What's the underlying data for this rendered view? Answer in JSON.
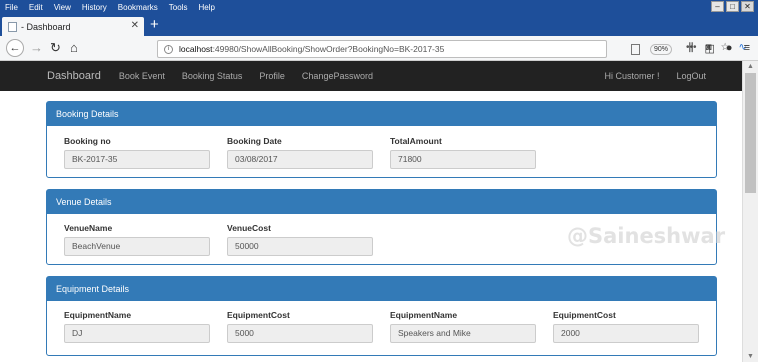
{
  "browser": {
    "menu": [
      "File",
      "Edit",
      "View",
      "History",
      "Bookmarks",
      "Tools",
      "Help"
    ],
    "tab_title": "- Dashboard",
    "url_host": "localhost",
    "url_path": ":49980/ShowAllBooking/ShowOrder?BookingNo=BK-2017-35",
    "zoom": "90%"
  },
  "nav": {
    "brand": "Dashboard",
    "links": [
      "Book Event",
      "Booking Status",
      "Profile",
      "ChangePassword"
    ],
    "greeting": "Hi Customer !",
    "logout": "LogOut"
  },
  "booking": {
    "heading": "Booking Details",
    "fields": [
      {
        "label": "Booking no",
        "value": "BK-2017-35"
      },
      {
        "label": "Booking Date",
        "value": "03/08/2017"
      },
      {
        "label": "TotalAmount",
        "value": "71800"
      }
    ]
  },
  "venue": {
    "heading": "Venue Details",
    "fields": [
      {
        "label": "VenueName",
        "value": "BeachVenue"
      },
      {
        "label": "VenueCost",
        "value": "50000"
      }
    ]
  },
  "equipment": {
    "heading": "Equipment Details",
    "fields": [
      {
        "label": "EquipmentName",
        "value": "DJ"
      },
      {
        "label": "EquipmentCost",
        "value": "5000"
      },
      {
        "label": "EquipmentName",
        "value": "Speakers and Mike"
      },
      {
        "label": "EquipmentCost",
        "value": "2000"
      }
    ]
  },
  "watermark": "@Saineshwar"
}
